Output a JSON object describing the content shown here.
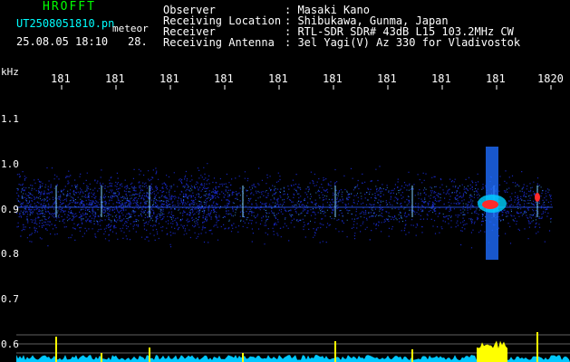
{
  "app_title": "HROFFT",
  "file": {
    "name": "UT2508051810.pn",
    "suffix": "meteor"
  },
  "datetime": "25.08.05 18:10",
  "count": "28.",
  "meta": [
    {
      "label": "Observer",
      "value": ": Masaki Kano"
    },
    {
      "label": "Receiving Location",
      "value": ": Shibukawa, Gunma, Japan"
    },
    {
      "label": "Receiver",
      "value": ": RTL-SDR SDR# 43dB L15 103.2MHz CW"
    },
    {
      "label": "Receiving Antenna",
      "value": ": 3el Yagi(V) Az 330 for Vladivostok"
    }
  ],
  "y_unit": "kHz",
  "time_ticks": [
    "181",
    "181",
    "181",
    "181",
    "181",
    "181",
    "181",
    "181",
    "181",
    "1820"
  ],
  "y_ticks": [
    "1.1",
    "1.0",
    "0.9",
    "0.8",
    "0.7",
    "0.6"
  ],
  "colors": {
    "title": "#00ff00",
    "filename": "#00ffff",
    "noise": "#1a2bd6",
    "echo": "#ff2a2a",
    "level": "#ffff00",
    "baseline": "#00c8ff"
  }
}
